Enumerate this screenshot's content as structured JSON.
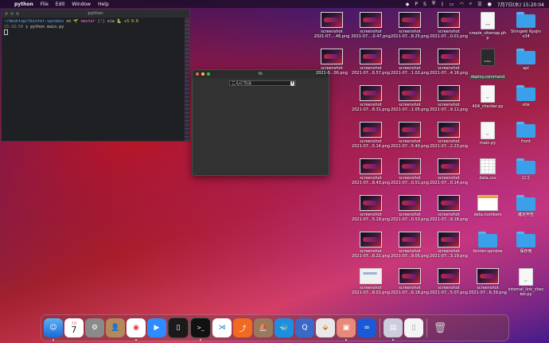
{
  "menubar": {
    "app_name": "python",
    "menus": [
      "File",
      "Edit",
      "Window",
      "Help"
    ],
    "clock": "7月7日(水) 15:20:04"
  },
  "terminal": {
    "title": "python",
    "line1_path": "~/desktop/tkinter-spinbox",
    "line1_on": "on",
    "line1_branch": "🌱 master [!]",
    "line1_via": "via",
    "line1_py": "🐍 v3.9.6",
    "line2_time": "15:18:50",
    "line2_prompt": "❯ python main.py"
  },
  "tk_window": {
    "title": "tk",
    "spinbox_value": "こんにちは",
    "spin_arrows": "⬍"
  },
  "desktop_icons": [
    {
      "label1": "screenshot",
      "label2": "2021-07....46.png",
      "kind": "shot"
    },
    {
      "label1": "screenshot",
      "label2": "2021-07....0.47.png",
      "kind": "shot"
    },
    {
      "label1": "screenshot",
      "label2": "2021-07...8.25.png",
      "kind": "shot"
    },
    {
      "label1": "screenshot",
      "label2": "2021-07...0.01.png",
      "kind": "shot"
    },
    {
      "label1": "create_sitemap.ph",
      "label2": "p",
      "kind": "doc",
      "tag": "PHP"
    },
    {
      "label1": "Shingeki Kyojin",
      "label2": "v34",
      "kind": "folder"
    },
    {
      "label1": "screenshot",
      "label2": "2021-0...00.png",
      "kind": "shot"
    },
    {
      "label1": "screenshot",
      "label2": "2021-07...6.57.png",
      "kind": "shot"
    },
    {
      "label1": "screenshot",
      "label2": "2021-07...1.02.png",
      "kind": "shot"
    },
    {
      "label1": "screenshot",
      "label2": "2021-07...4.16.png",
      "kind": "shot"
    },
    {
      "label1": "deploy.command",
      "label2": "",
      "kind": "docdark",
      "tag": "SHELL"
    },
    {
      "label1": "api",
      "label2": "",
      "kind": "folder"
    },
    {
      "label1": "screenshot",
      "label2": "2021-07...8.31.png",
      "kind": "shot"
    },
    {
      "label1": "screenshot",
      "label2": "2021-07...1.05.png",
      "kind": "shot"
    },
    {
      "label1": "screenshot",
      "label2": "2021-07...9.11.png",
      "kind": "shot"
    },
    {
      "label1": "404_checker.py",
      "label2": "",
      "kind": "doc",
      "tag": "PY"
    },
    {
      "label1": "site",
      "label2": "",
      "kind": "folder"
    },
    {
      "label1": "screenshot",
      "label2": "2021-07...5.14.png",
      "kind": "shot"
    },
    {
      "label1": "screenshot",
      "label2": "2021-07...5.40.png",
      "kind": "shot"
    },
    {
      "label1": "screenshot",
      "label2": "2021-07...2.23.png",
      "kind": "shot"
    },
    {
      "label1": "main.py",
      "label2": "",
      "kind": "doc",
      "tag": "PY"
    },
    {
      "label1": "front",
      "label2": "",
      "kind": "folder"
    },
    {
      "label1": "screenshot",
      "label2": "2021-07...8.43.png",
      "kind": "shot"
    },
    {
      "label1": "screenshot",
      "label2": "2021-07...0.51.png",
      "kind": "shot"
    },
    {
      "label1": "screenshot",
      "label2": "2021-07...0.14.png",
      "kind": "shot"
    },
    {
      "label1": "data.csv",
      "label2": "",
      "kind": "csv"
    },
    {
      "label1": "ロゴ",
      "label2": "",
      "kind": "folder"
    },
    {
      "label1": "screenshot",
      "label2": "2021-07...5.19.png",
      "kind": "shot"
    },
    {
      "label1": "screenshot",
      "label2": "2021-07...0.53.png",
      "kind": "shot"
    },
    {
      "label1": "screenshot",
      "label2": "2021-07...9.18.png",
      "kind": "shot"
    },
    {
      "label1": "data.numbers",
      "label2": "",
      "kind": "numbers"
    },
    {
      "label1": "確定申告",
      "label2": "",
      "kind": "folder"
    },
    {
      "label1": "screenshot",
      "label2": "2021-07...6.22.png",
      "kind": "shot"
    },
    {
      "label1": "screenshot",
      "label2": "2021-07...9.05.png",
      "kind": "shot"
    },
    {
      "label1": "screenshot",
      "label2": "2021-07...3.19.png",
      "kind": "shot"
    },
    {
      "label1": "tkinter-spinbox",
      "label2": "",
      "kind": "folder"
    },
    {
      "label1": "保存用",
      "label2": "",
      "kind": "folder"
    },
    {
      "label1": "screenshot",
      "label2": "2021-07...8.01.png",
      "kind": "shotwhite"
    },
    {
      "label1": "screenshot",
      "label2": "2021-07...6.18.png",
      "kind": "shot"
    },
    {
      "label1": "screenshot",
      "label2": "2021-07...5.07.png",
      "kind": "shot"
    },
    {
      "label1": "screenshot",
      "label2": "2021-07...6.39.png",
      "kind": "shot"
    },
    {
      "label1": "internal_link_chec",
      "label2": "ker.py",
      "kind": "doc",
      "tag": "PY"
    }
  ],
  "dock": {
    "calendar_month": "7月",
    "calendar_day": "7"
  }
}
